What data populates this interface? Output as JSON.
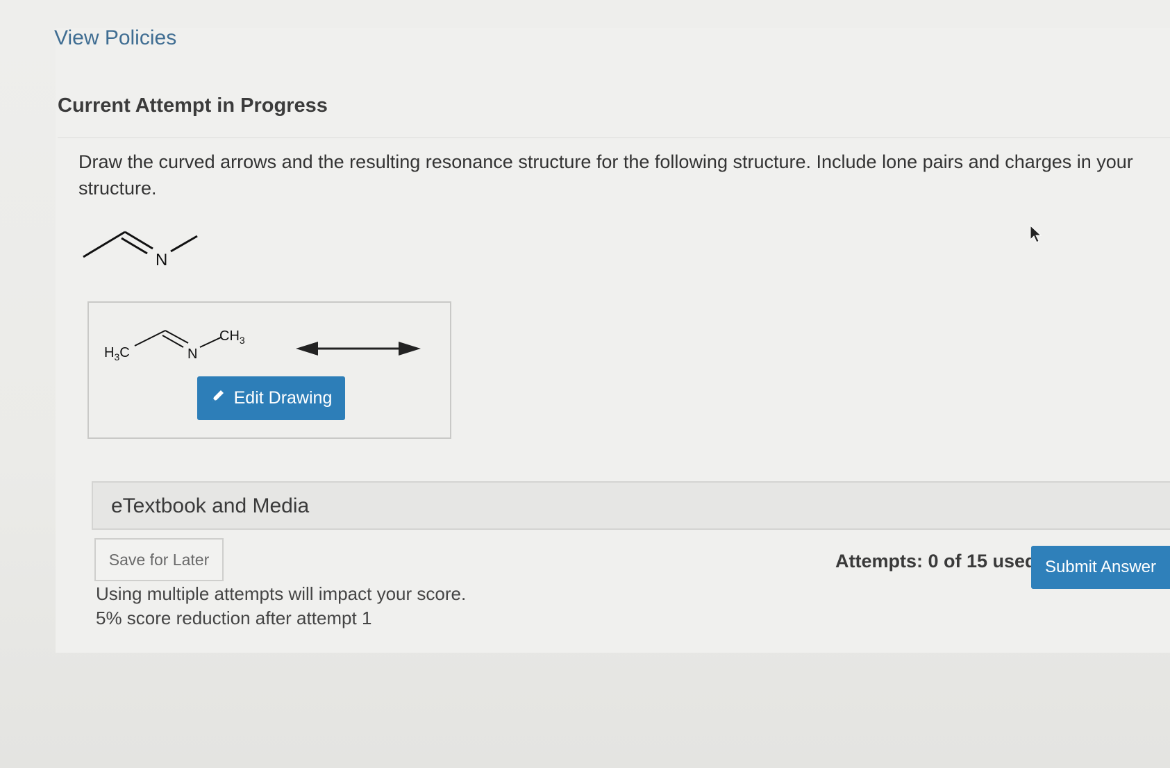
{
  "header": {
    "view_policies": "View Policies",
    "section_title": "Current Attempt in Progress"
  },
  "question": {
    "prompt": "Draw the curved arrows and the resulting resonance structure for the following structure. Include lone pairs and charges in your structure.",
    "structure_atom": "N"
  },
  "drawing": {
    "left_group": "H3C",
    "nitrogen": "N",
    "right_group": "CH3",
    "edit_button": "Edit Drawing",
    "arrow_type": "resonance-double-headed-arrow"
  },
  "etextbook": {
    "label": "eTextbook and Media"
  },
  "footer": {
    "save_label": "Save for Later",
    "note_line1": "Using multiple attempts will impact your score.",
    "note_line2": "5% score reduction after attempt 1",
    "attempts_text": "Attempts: 0 of 15 used",
    "submit_label": "Submit Answer"
  },
  "colors": {
    "link": "#3f6d92",
    "primary_button": "#2d7eb8",
    "text": "#3a3a3a"
  },
  "icons": {
    "edit": "pencil-icon",
    "cursor": "mouse-cursor-icon"
  }
}
